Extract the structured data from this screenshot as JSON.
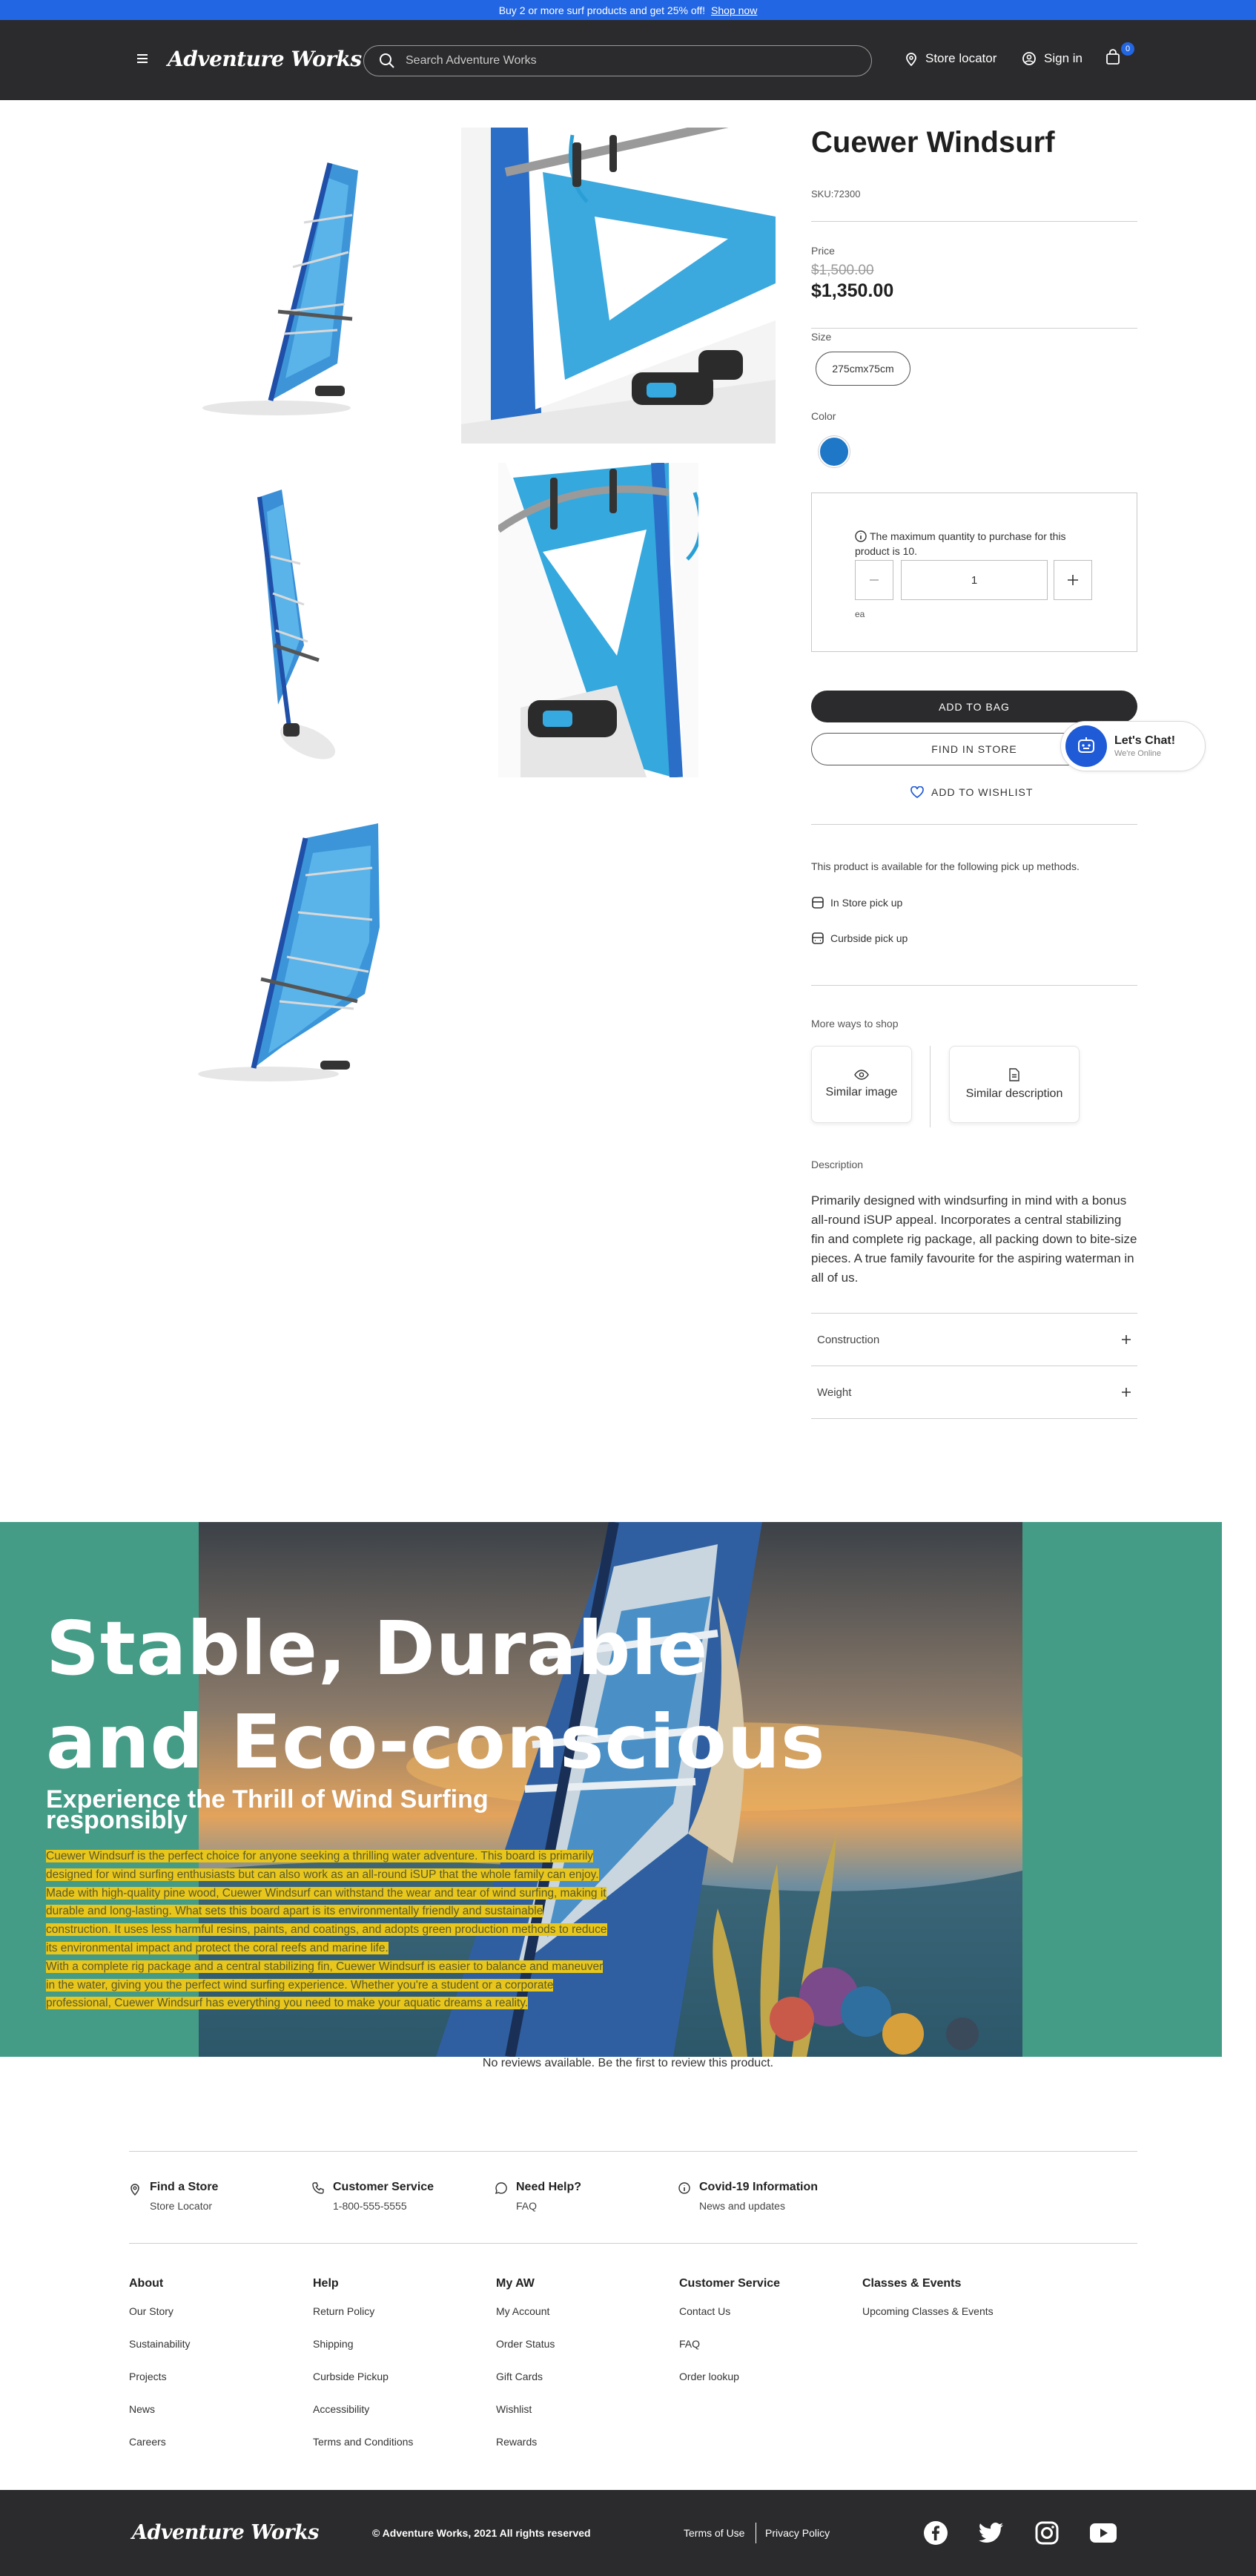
{
  "promo": {
    "text": "Buy 2 or more surf products and get 25% off!",
    "link": "Shop now"
  },
  "header": {
    "brand": "Adventure Works",
    "search_placeholder": "Search Adventure Works",
    "store_locator": "Store locator",
    "sign_in": "Sign in",
    "cart_count": "0"
  },
  "product": {
    "title": "Cuewer Windsurf",
    "sku": "SKU:72300",
    "price_label": "Price",
    "old_price": "$1,500.00",
    "price": "$1,350.00",
    "size_label": "Size",
    "size_value": "275cmx75cm",
    "color_label": "Color",
    "color_swatch": "#1f77c8",
    "qty_note": "The maximum quantity to purchase for this product is 10.",
    "qty_value": "1",
    "qty_unit": "ea",
    "add_to_bag": "ADD TO BAG",
    "find_in_store": "FIND IN STORE",
    "wishlist": "ADD TO WISHLIST",
    "pickup_intro": "This product is available for the following pick up methods.",
    "pickup_store": "In Store pick up",
    "pickup_curbside": "Curbside pick up",
    "more_ways": "More ways to shop",
    "similar_image": "Similar image",
    "similar_description": "Similar description",
    "description_label": "Description",
    "description": "Primarily designed with windsurfing in mind with a bonus all-round iSUP appeal. Incorporates a central stabilizing fin and complete rig package, all packing down to bite-size pieces. A true family favourite for the aspiring waterman in all of us.",
    "construction": "Construction",
    "weight": "Weight"
  },
  "chat": {
    "title": "Let's Chat!",
    "status": "We're Online"
  },
  "hero": {
    "headline_1": "Stable, Durable",
    "headline_2": "and Eco-conscious",
    "subhead": "Experience the Thrill of Wind Surfing responsibly",
    "para_1": "Cuewer Windsurf is the perfect choice for anyone seeking a thrilling water adventure. This board is primarily designed for wind surfing enthusiasts but can also work as an all-round iSUP that the whole family can enjoy.",
    "para_2": "Made with high-quality pine wood, Cuewer Windsurf can withstand the wear and tear of wind surfing, making it durable and long-lasting. What sets this board apart is its environmentally friendly and sustainable construction. It uses less harmful resins, paints, and coatings, and adopts green production methods to reduce its environmental impact and protect the coral reefs and marine life.",
    "para_3": "With a complete rig package and a central stabilizing fin, Cuewer Windsurf is easier to balance and maneuver in the water, giving you the perfect wind surfing experience. Whether you're a student or a corporate professional, Cuewer Windsurf has everything you need to make your aquatic dreams a reality."
  },
  "reviews": {
    "empty": "No reviews available. Be the first to review this product."
  },
  "footer_help": [
    {
      "title": "Find a Store",
      "sub": "Store Locator",
      "icon": "map-pin-icon"
    },
    {
      "title": "Customer Service",
      "sub": "1-800-555-5555",
      "icon": "phone-icon"
    },
    {
      "title": "Need Help?",
      "sub": "FAQ",
      "icon": "chat-bubble-icon"
    },
    {
      "title": "Covid-19 Information",
      "sub": "News and updates",
      "icon": "info-icon"
    }
  ],
  "footer_cols": [
    {
      "heading": "About",
      "items": [
        "Our Story",
        "Sustainability",
        "Projects",
        "News",
        "Careers"
      ]
    },
    {
      "heading": "Help",
      "items": [
        "Return Policy",
        "Shipping",
        "Curbside Pickup",
        "Accessibility",
        "Terms and Conditions"
      ]
    },
    {
      "heading": "My AW",
      "items": [
        "My Account",
        "Order Status",
        "Gift Cards",
        "Wishlist",
        "Rewards"
      ]
    },
    {
      "heading": "Customer Service",
      "items": [
        "Contact Us",
        "FAQ",
        "Order lookup"
      ]
    },
    {
      "heading": "Classes & Events",
      "items": [
        "Upcoming Classes & Events"
      ]
    }
  ],
  "bottom": {
    "brand": "Adventure Works",
    "copyright": "© Adventure Works, 2021 All rights reserved",
    "terms": "Terms of Use",
    "privacy": "Privacy Policy",
    "social": [
      "facebook-icon",
      "twitter-icon",
      "instagram-icon",
      "youtube-icon"
    ]
  }
}
